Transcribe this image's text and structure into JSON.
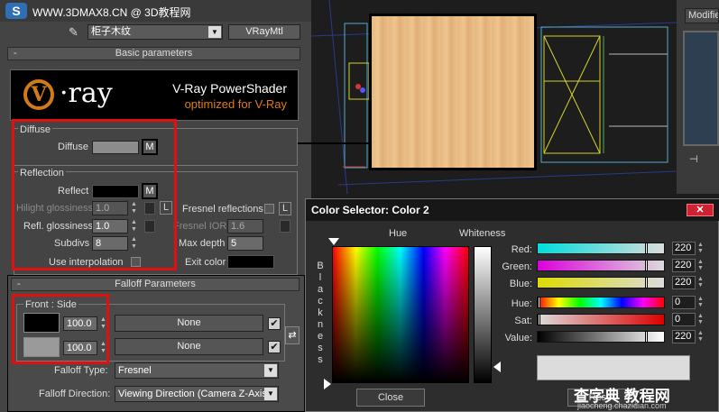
{
  "header": {
    "watermark": "WWW.3DMAX8.CN @ 3D教程网",
    "logo_letter": "S"
  },
  "material": {
    "name": "柜子木纹",
    "type_button": "VRayMtl"
  },
  "basic_params": {
    "title": "Basic parameters",
    "collapse": "-"
  },
  "banner": {
    "vray_logo": "V·ray",
    "line1": "V-Ray PowerShader",
    "line2": "optimized for V-Ray"
  },
  "diffuse": {
    "group_label": "Diffuse",
    "label": "Diffuse",
    "map_btn": "M",
    "swatch_color": "#8c8c8c"
  },
  "reflection": {
    "group_label": "Reflection",
    "reflect_label": "Reflect",
    "map_btn": "M",
    "swatch_color": "#000000",
    "hilight_label": "Hilight glossiness",
    "hilight_value": "1.0",
    "hilight_lock": "L",
    "refl_gloss_label": "Refl. glossiness",
    "refl_gloss_value": "1.0",
    "subdivs_label": "Subdivs",
    "subdivs_value": "8",
    "use_interp_label": "Use interpolation",
    "fresnel_label": "Fresnel reflections",
    "fresnel_lock": "L",
    "fresnel_ior_label": "Fresnel IOR",
    "fresnel_ior_value": "1.6",
    "max_depth_label": "Max depth",
    "max_depth_value": "5",
    "exit_color_label": "Exit color"
  },
  "falloff": {
    "title": "Falloff Parameters",
    "collapse": "-",
    "group_label": "Front : Side",
    "row1": {
      "swatch": "#000000",
      "amount": "100.0",
      "map": "None",
      "check": "✔"
    },
    "row2": {
      "swatch": "#9a9a9a",
      "amount": "100.0",
      "map": "None",
      "check": "✔"
    },
    "swap": "⇄",
    "type_label": "Falloff Type:",
    "type_value": "Fresnel",
    "direction_label": "Falloff Direction:",
    "direction_value": "Viewing Direction (Camera Z-Axis)"
  },
  "viewport": {
    "modifier_label": "Modifier"
  },
  "color_selector": {
    "title": "Color Selector: Color 2",
    "close": "✕",
    "hue_label": "Hue",
    "whiteness_label": "Whiteness",
    "blackness_letters": [
      "B",
      "l",
      "a",
      "c",
      "k",
      "n",
      "e",
      "s",
      "s"
    ],
    "sliders": [
      {
        "label": "Red:",
        "value": "220"
      },
      {
        "label": "Green:",
        "value": "220"
      },
      {
        "label": "Blue:",
        "value": "220"
      },
      {
        "label": "Hue:",
        "value": "0"
      },
      {
        "label": "Sat:",
        "value": "0"
      },
      {
        "label": "Value:",
        "value": "220"
      }
    ],
    "close_button": "Close",
    "reset_button": "Reset"
  },
  "footer_watermark": {
    "line1": "查字典 教程网",
    "line2": "jiaocheng.chazidian.com"
  },
  "colors": {
    "highlight_red": "#e01010",
    "vray_orange": "#d07a1a"
  }
}
